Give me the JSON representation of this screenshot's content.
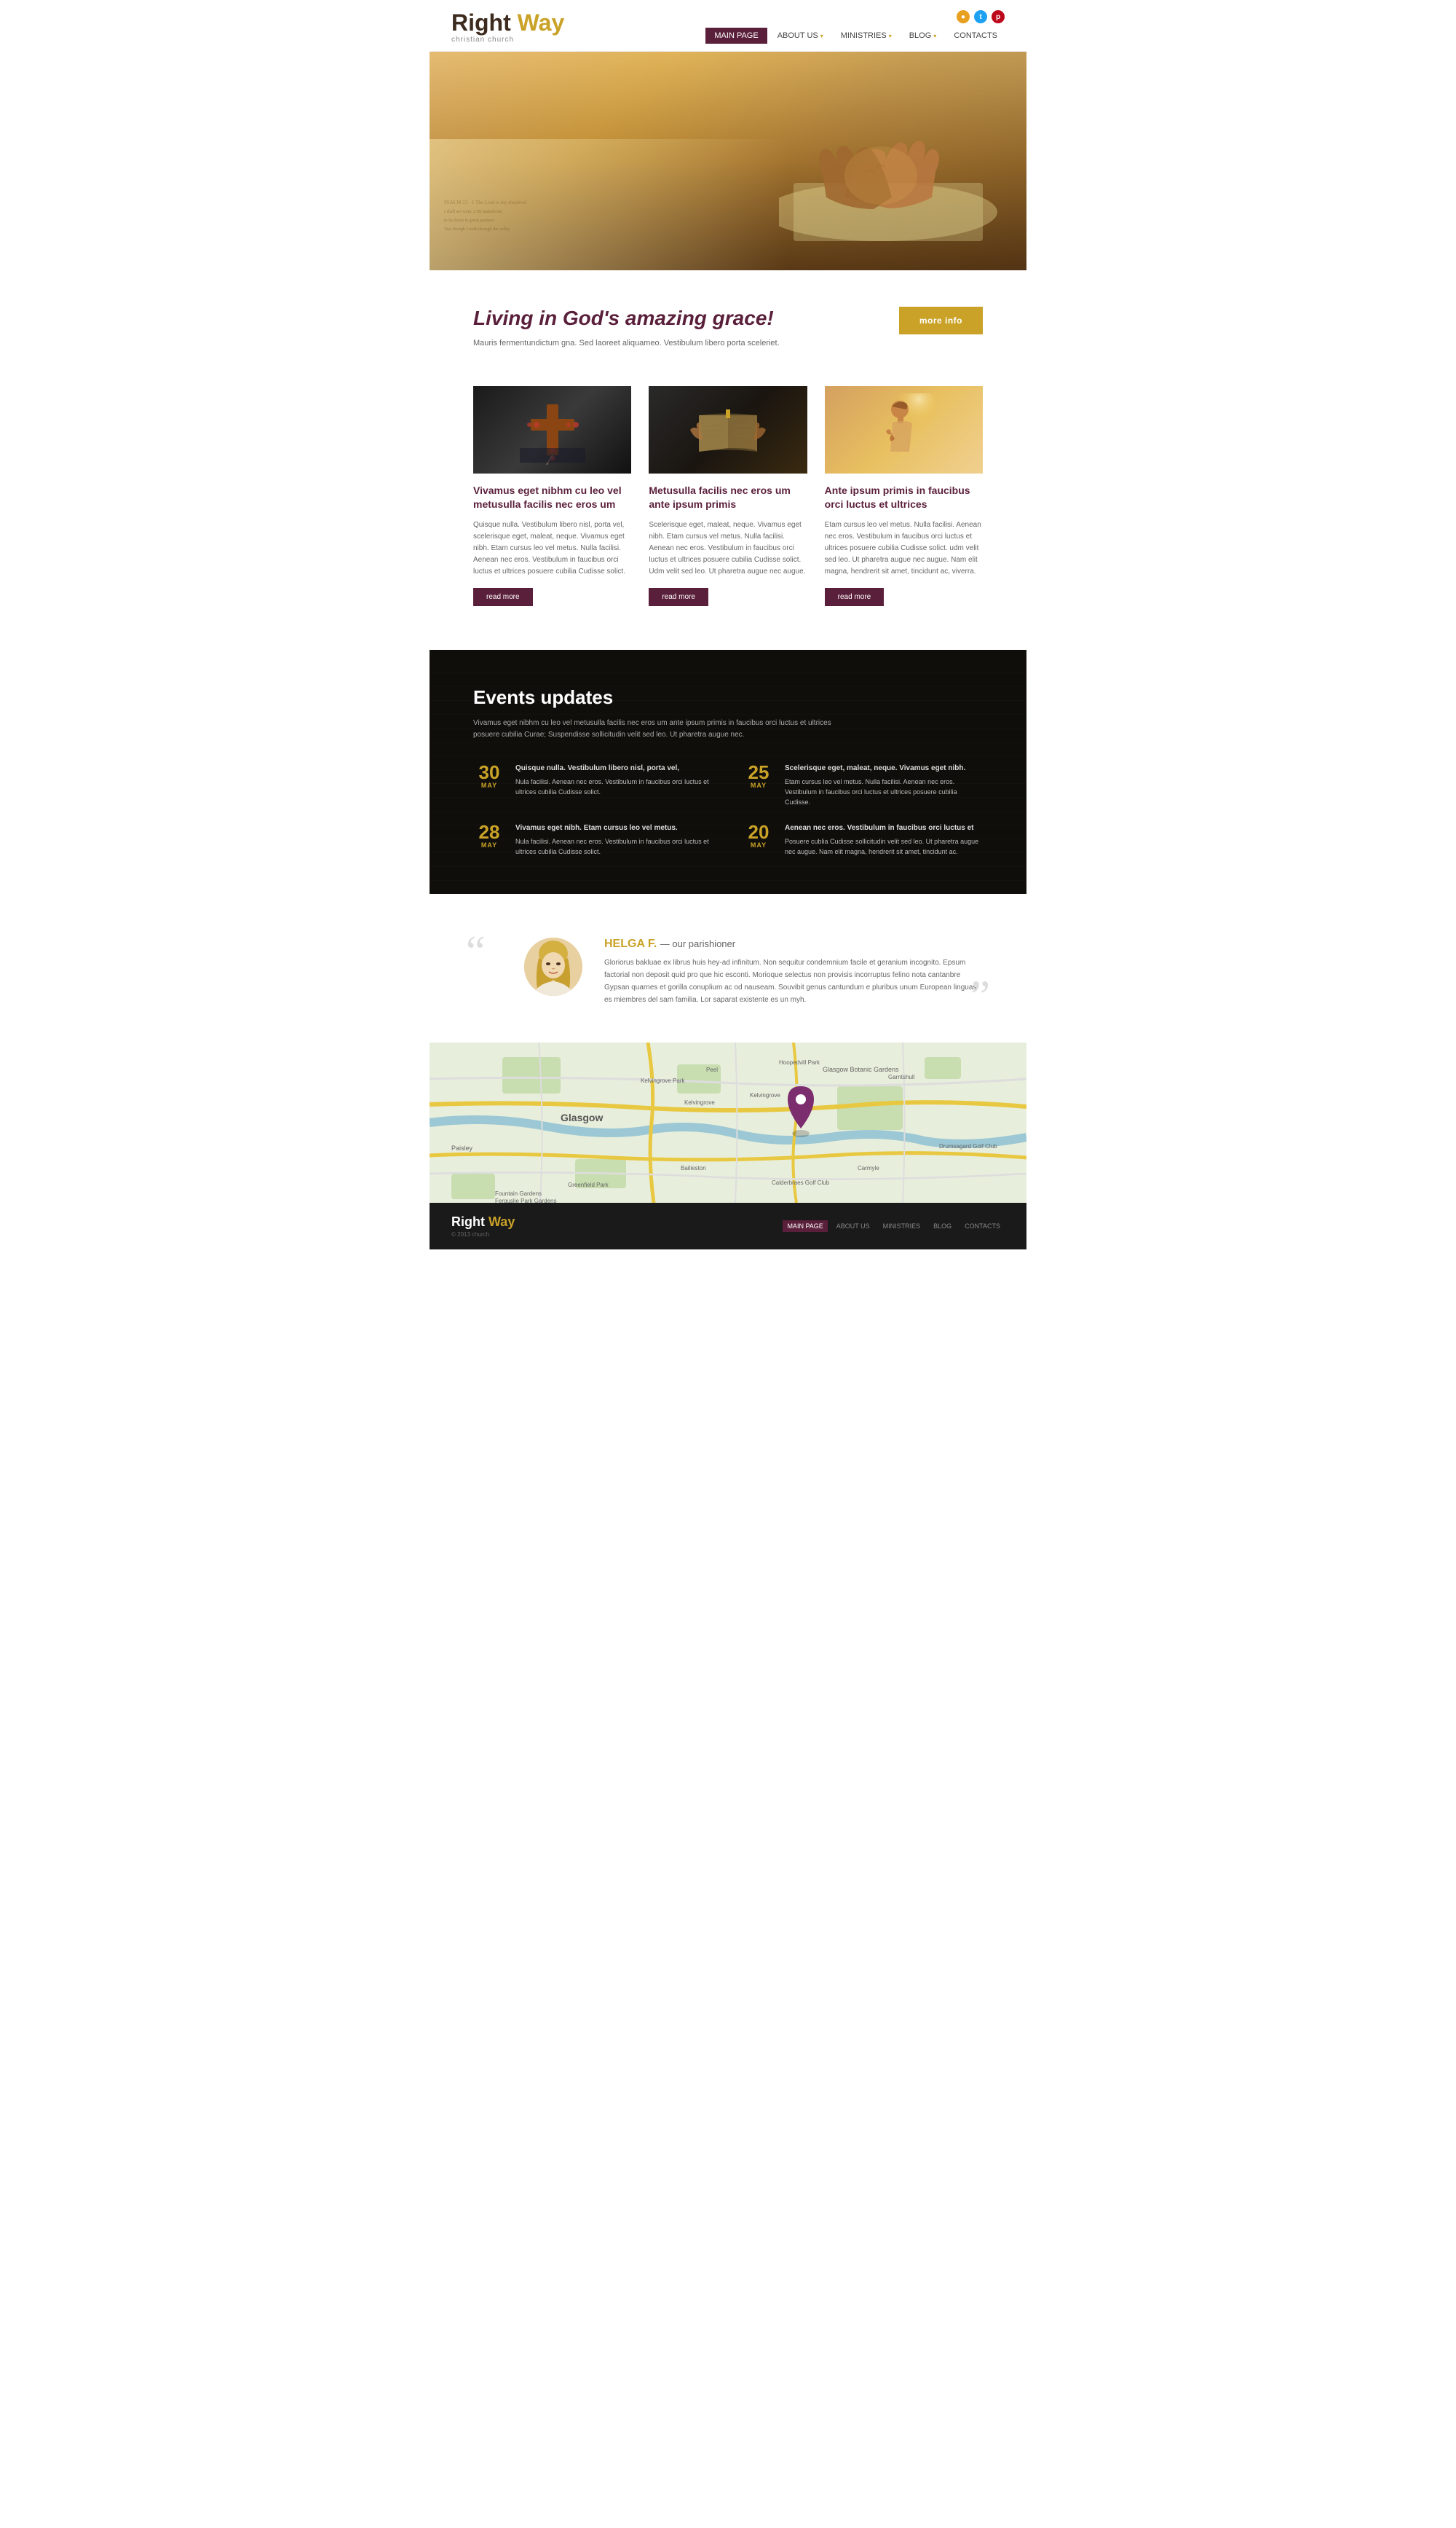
{
  "header": {
    "logo_right": "Right",
    "logo_way": " Way",
    "logo_sub": "christian church",
    "social": [
      {
        "name": "rss",
        "icon": "r"
      },
      {
        "name": "twitter",
        "icon": "t"
      },
      {
        "name": "pinterest",
        "icon": "p"
      }
    ],
    "nav": [
      {
        "label": "MAIN PAGE",
        "active": true,
        "has_arrow": false
      },
      {
        "label": "ABOUT US",
        "active": false,
        "has_arrow": true
      },
      {
        "label": "MINISTRIES",
        "active": false,
        "has_arrow": true
      },
      {
        "label": "BLOG",
        "active": false,
        "has_arrow": true
      },
      {
        "label": "CONTACTS",
        "active": false,
        "has_arrow": false
      }
    ]
  },
  "grace": {
    "title": "Living in God's amazing grace!",
    "subtitle": "Mauris fermentundictum gna.  Sed laoreet aliquameo. Vestibulum libero porta sceleriet.",
    "more_info_label": "more info"
  },
  "cards": [
    {
      "title": "Vivamus eget nibhm cu leo vel metusulla facilis nec eros um",
      "text": "Quisque nulla. Vestibulum libero nisl, porta vel, scelerisque eget, maleat, neque. Vivamus eget nibh. Etam cursus leo vel metus. Nulla facilisi. Aenean nec eros. Vestibulum  in faucibus orci luctus et ultrices posuere cubilia Cudisse solict.",
      "read_more": "read more",
      "img_type": "cross"
    },
    {
      "title": "Metusulla facilis nec eros um ante ipsum primis",
      "text": "Scelerisque eget, maleat, neque. Vivamus eget nibh. Etam cursus vel metus. Nulla facilisi. Aenean nec eros. Vestibulum  in faucibus orci luctus et ultrices posuere cubilia Cudisse solict. Udm velit sed leo. Ut pharetra augue nec augue.",
      "read_more": "read more",
      "img_type": "book"
    },
    {
      "title": "Ante ipsum primis  in faucibus orci luctus et ultrices",
      "text": "Etam cursus leo vel metus. Nulla facilisi. Aenean nec eros. Vestibulum  in faucibus orci luctus et ultrices posuere cubilia Cudisse solict. udm velit sed leo. Ut pharetra augue nec augue. Nam elit magna, hendrerit sit amet, tincidunt ac, viverra.",
      "read_more": "read more",
      "img_type": "pray"
    }
  ],
  "events": {
    "title": "Events updates",
    "description": "Vivamus eget nibhm cu leo vel metusulla facilis nec eros um ante ipsum primis  in faucibus orci luctus et ultrices posuere cubilia Curae; Suspendisse sollicitudin velit sed leo. Ut pharetra augue nec.",
    "items": [
      {
        "day": "30",
        "month": "MAY",
        "title": "Quisque nulla. Vestibulum libero nisl, porta vel,",
        "text": "Nula facilisi. Aenean nec eros. Vestibulum  in faucibus orci luctus et ultrices cubilia Cudisse solict."
      },
      {
        "day": "25",
        "month": "MAY",
        "title": "Scelerisque eget, maleat, neque. Vivamus eget nibh.",
        "text": "Etam cursus leo vel metus. Nulla facilisi. Aenean nec eros. Vestibulum  in faucibus orci luctus et ultrices posuere cubilia Cudisse."
      },
      {
        "day": "28",
        "month": "MAY",
        "title": "Vivamus eget nibh. Etam cursus leo vel metus.",
        "text": "Nula facilisi. Aenean nec eros. Vestibulum  in faucibus orci luctus et ultrices cubilia Cudisse solict."
      },
      {
        "day": "20",
        "month": "MAY",
        "title": "Aenean nec eros. Vestibulum in faucibus orci luctus et",
        "text": "Posuere cublia Cudisse sollicitudin velit sed leo. Ut pharetra augue nec augue. Nam elit magna, hendrerit sit amet, tincidunt ac."
      }
    ]
  },
  "testimonial": {
    "quote_open": "“",
    "quote_close": "”",
    "name": "HELGA F.",
    "role": "our parishioner",
    "text": "Gloriorus bakluae ex librus huis hey-ad infinitum. Non sequitur condemnium facile et geranium incognito. Epsum factorial non deposit quid pro que hic esconti. Morioque selectus non provisis incorruptus felino nota cantanbre Gypsan quarnes et gorilla conuplium ac od nauseam. Souvibit genus cantundum e pluribus unum European linguas es miembres del sam familia. Lor saparat existente es un myh."
  },
  "footer": {
    "logo_right": "Right",
    "logo_way": " Way",
    "copy": "© 2013 church",
    "nav": [
      {
        "label": "MAIN PAGE",
        "active": true
      },
      {
        "label": "ABOUT US",
        "active": false
      },
      {
        "label": "MINISTRIES",
        "active": false
      },
      {
        "label": "BLOG",
        "active": false
      },
      {
        "label": "CONTACTS",
        "active": false
      }
    ]
  }
}
